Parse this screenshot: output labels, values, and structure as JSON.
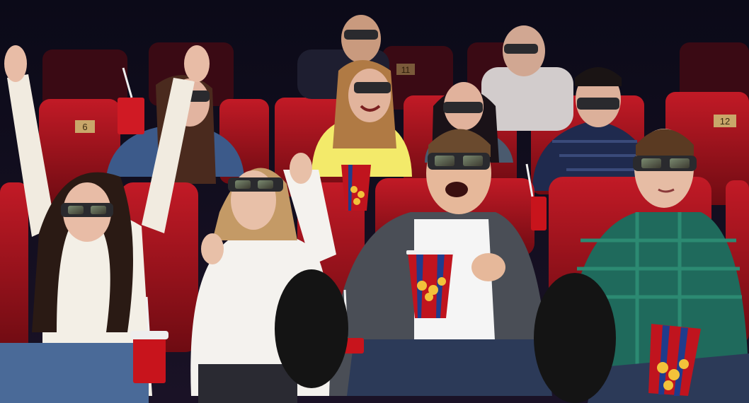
{
  "scene": {
    "kind": "photo",
    "subject": "audience-watching-3d-movie",
    "seat_numbers": [
      "6",
      "12",
      "11"
    ],
    "colors": {
      "wall": "#141226",
      "seat_red": "#a8121c",
      "seat_dark": "#5c0a10",
      "glasses_frame": "#2a2a2e",
      "popcorn_cup_red": "#c0141e",
      "popcorn_cup_blue": "#1f3c8c",
      "popcorn": "#f2c23a"
    },
    "icons": [
      "3d-glasses-icon",
      "popcorn-cup-icon",
      "soda-cup-icon",
      "cinema-seat-icon"
    ]
  }
}
